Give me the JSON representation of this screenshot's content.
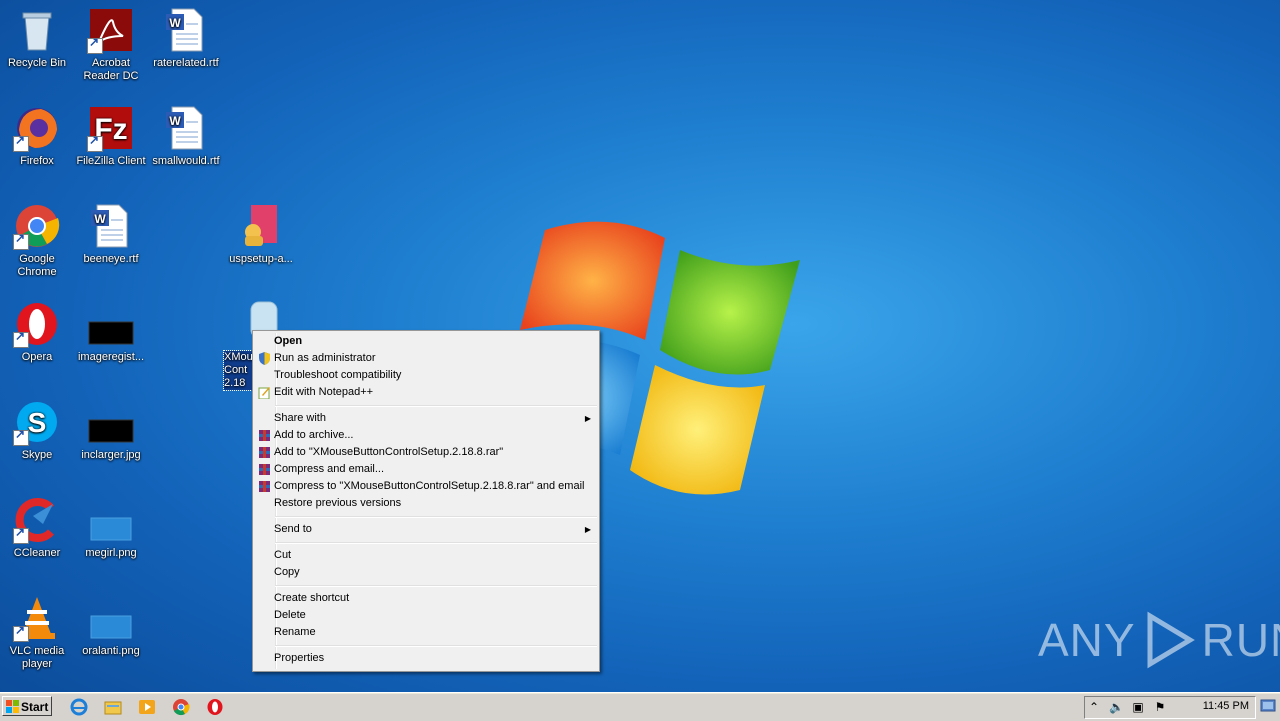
{
  "desktop": {
    "icons": [
      {
        "label": "Recycle Bin",
        "icon": "recycle-bin-icon"
      },
      {
        "label": "Acrobat Reader DC",
        "icon": "acrobat-icon"
      },
      {
        "label": "raterelated.rtf",
        "icon": "word-doc-icon"
      },
      {
        "label": "Firefox",
        "icon": "firefox-icon"
      },
      {
        "label": "FileZilla Client",
        "icon": "filezilla-icon"
      },
      {
        "label": "smallwould.rtf",
        "icon": "word-doc-icon"
      },
      {
        "label": "Google Chrome",
        "icon": "chrome-icon"
      },
      {
        "label": "beeneye.rtf",
        "icon": "word-doc-icon"
      },
      {
        "label": "uspsetup-a...",
        "icon": "installer-icon"
      },
      {
        "label": "Opera",
        "icon": "opera-icon"
      },
      {
        "label": "imageregist...",
        "icon": "image-thumb-icon"
      },
      {
        "label": "XMou Cont 2.18",
        "icon": "xmouse-icon"
      },
      {
        "label": "Skype",
        "icon": "skype-icon"
      },
      {
        "label": "inclarger.jpg",
        "icon": "image-thumb-icon"
      },
      {
        "label": "CCleaner",
        "icon": "ccleaner-icon"
      },
      {
        "label": "megirl.png",
        "icon": "image-thumb-icon"
      },
      {
        "label": "VLC media player",
        "icon": "vlc-icon"
      },
      {
        "label": "oralanti.png",
        "icon": "image-thumb-icon"
      }
    ]
  },
  "context_menu": {
    "items": [
      {
        "label": "Open"
      },
      {
        "label": "Run as administrator"
      },
      {
        "label": "Troubleshoot compatibility"
      },
      {
        "label": "Edit with Notepad++"
      },
      {
        "label": "Share with"
      },
      {
        "label": "Add to archive..."
      },
      {
        "label": "Add to \"XMouseButtonControlSetup.2.18.8.rar\""
      },
      {
        "label": "Compress and email..."
      },
      {
        "label": "Compress to \"XMouseButtonControlSetup.2.18.8.rar\" and email"
      },
      {
        "label": "Restore previous versions"
      },
      {
        "label": "Send to"
      },
      {
        "label": "Cut"
      },
      {
        "label": "Copy"
      },
      {
        "label": "Create shortcut"
      },
      {
        "label": "Delete"
      },
      {
        "label": "Rename"
      },
      {
        "label": "Properties"
      }
    ]
  },
  "taskbar": {
    "start_label": "Start",
    "clock": "11:45 PM",
    "quick_launch": [
      "ie-icon",
      "explorer-icon",
      "media-player-icon",
      "chrome-icon",
      "opera-icon"
    ]
  },
  "watermark": "ANY RUN"
}
